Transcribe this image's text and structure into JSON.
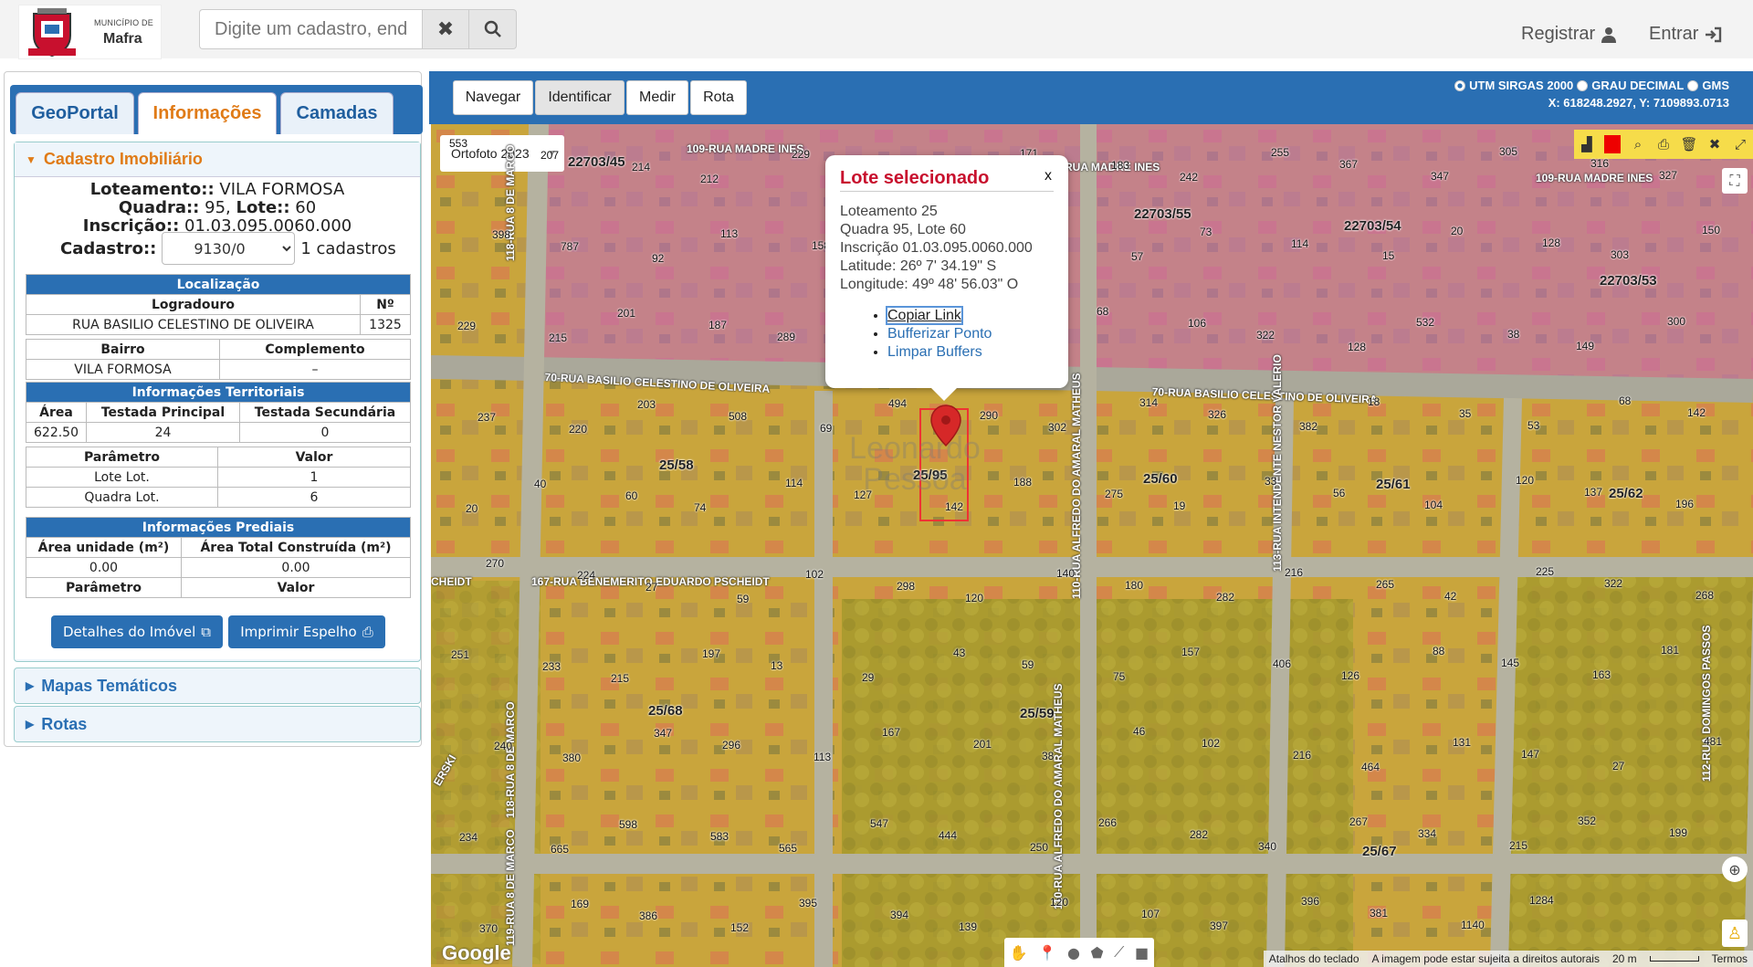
{
  "header": {
    "municipality_caption": "MUNICÍPIO DE",
    "city": "Mafra",
    "search_placeholder": "Digite um cadastro, endereço",
    "register_label": "Registrar",
    "login_label": "Entrar"
  },
  "tabs": [
    "GeoPortal",
    "Informações",
    "Camadas"
  ],
  "cadastro": {
    "section_title": "Cadastro Imobiliário",
    "loteamento_label": "Loteamento::",
    "loteamento_value": "VILA FORMOSA",
    "quadra_label": "Quadra::",
    "quadra_value": "95,",
    "lote_label": "Lote::",
    "lote_value": "60",
    "inscricao_label": "Inscrição::",
    "inscricao_value": "01.03.095.0060.000",
    "cadastro_label": "Cadastro::",
    "cadastro_selected": "9130/0",
    "cadastro_count": "1 cadastros"
  },
  "localizacao": {
    "title": "Localização",
    "col_logradouro": "Logradouro",
    "col_numero": "Nº",
    "logradouro": "RUA BASILIO CELESTINO DE OLIVEIRA",
    "numero": "1325",
    "col_bairro": "Bairro",
    "col_complemento": "Complemento",
    "bairro": "VILA FORMOSA",
    "complemento": "–"
  },
  "territoriais": {
    "title": "Informações Territoriais",
    "col_area": "Área",
    "col_testada_principal": "Testada Principal",
    "col_testada_secundaria": "Testada Secundária",
    "area": "622.50",
    "testada_principal": "24",
    "testada_secundaria": "0",
    "col_parametro": "Parâmetro",
    "col_valor": "Valor",
    "rows": [
      {
        "param": "Lote Lot.",
        "valor": "1"
      },
      {
        "param": "Quadra Lot.",
        "valor": "6"
      }
    ]
  },
  "prediais": {
    "title": "Informações Prediais",
    "col_area_unidade": "Área unidade (m²)",
    "col_area_total": "Área Total Construída (m²)",
    "area_unidade": "0.00",
    "area_total": "0.00",
    "col_parametro": "Parâmetro",
    "col_valor": "Valor"
  },
  "buttons": {
    "detalhes": "Detalhes do Imóvel",
    "imprimir": "Imprimir Espelho"
  },
  "sections": {
    "mapas_tematicos": "Mapas Temáticos",
    "rotas": "Rotas"
  },
  "map_toolbar": {
    "buttons": [
      "Navegar",
      "Identificar",
      "Medir",
      "Rota"
    ],
    "active": "Identificar",
    "coord_options": [
      "UTM SIRGAS 2000",
      "GRAU DECIMAL",
      "GMS"
    ],
    "coord_selected": "UTM SIRGAS 2000",
    "coord_readout": "X: 618248.2927, Y: 7109893.0713"
  },
  "map": {
    "basemap": "Ortofoto 2023",
    "accent_color": "#2a6fb3",
    "overlay_color": "#e3c21d",
    "highlight_color": "#c066c8",
    "street_labels": [
      "109-RUA MADRE INES",
      "109-RUA MADRE INES",
      "109-RUA MADRE INES",
      "70-RUA BASILIO CELESTINO DE OLIVEIRA",
      "70-RUA BASILIO CELESTINO DE OLIVEIRA",
      "167-RUA BENEMERITO EDUARDO PSCHEIDT",
      "118-RUA 8 DE MARCO",
      "118-RUA 8 DE MARCO",
      "110-RUA ALFREDO DO AMARAL MATHEUS",
      "110-RUA ALFREDO DO AMARAL MATHEUS",
      "113-RUA INTENDENTE NESTOR VALERIO",
      "119-RUA 8 DE MARCO",
      "112-RUA DOMINGOS PASSOS",
      "CHEIDT",
      "ERSKI"
    ],
    "block_labels": [
      "22703/45",
      "22703/55",
      "22703/54",
      "22703/53",
      "25/58",
      "25/95",
      "25/60",
      "25/61",
      "25/62",
      "25/68",
      "25/59",
      "25/67"
    ],
    "lot_numbers": [
      "553",
      "207",
      "214",
      "212",
      "229",
      "533",
      "159",
      "171",
      "183",
      "242",
      "255",
      "367",
      "347",
      "305",
      "316",
      "327",
      "398",
      "787",
      "92",
      "113",
      "158",
      "77",
      "25",
      "43",
      "57",
      "73",
      "114",
      "15",
      "20",
      "128",
      "303",
      "150",
      "229",
      "215",
      "201",
      "187",
      "289",
      "243",
      "19",
      "35",
      "68",
      "106",
      "322",
      "128",
      "532",
      "38",
      "149",
      "300",
      "237",
      "220",
      "203",
      "508",
      "69",
      "494",
      "290",
      "302",
      "314",
      "326",
      "382",
      "18",
      "35",
      "53",
      "68",
      "142",
      "20",
      "40",
      "60",
      "74",
      "114",
      "127",
      "142",
      "188",
      "275",
      "19",
      "33",
      "56",
      "104",
      "120",
      "137",
      "196",
      "270",
      "224",
      "27",
      "59",
      "102",
      "298",
      "120",
      "140",
      "180",
      "282",
      "216",
      "265",
      "42",
      "225",
      "322",
      "268",
      "251",
      "233",
      "215",
      "197",
      "13",
      "29",
      "43",
      "59",
      "75",
      "157",
      "406",
      "126",
      "88",
      "145",
      "163",
      "181",
      "240",
      "380",
      "347",
      "296",
      "113",
      "167",
      "201",
      "38",
      "46",
      "102",
      "216",
      "464",
      "131",
      "147",
      "27",
      "481",
      "234",
      "665",
      "598",
      "583",
      "565",
      "547",
      "444",
      "250",
      "266",
      "282",
      "340",
      "267",
      "334",
      "215",
      "352",
      "199",
      "370",
      "169",
      "386",
      "152",
      "395",
      "394",
      "139",
      "120",
      "107",
      "397",
      "396",
      "381",
      "1140",
      "1284"
    ],
    "popup": {
      "title": "Lote selecionado",
      "close": "x",
      "lines": [
        "Loteamento 25",
        "Quadra 95, Lote 60",
        "Inscrição 01.03.095.0060.000",
        "Latitude: 26º 7' 34.19\" S",
        "Longitude: 49º 48' 56.03\" O"
      ],
      "links": [
        "Copiar Link",
        "Bufferizar Ponto",
        "Limpar Buffers"
      ]
    },
    "watermark": "Leonardo Pessoa",
    "google_logo": "Google",
    "attribution": [
      "Atalhos do teclado",
      "A imagem pode estar sujeita a direitos autorais",
      "20 m",
      "Termos"
    ]
  }
}
